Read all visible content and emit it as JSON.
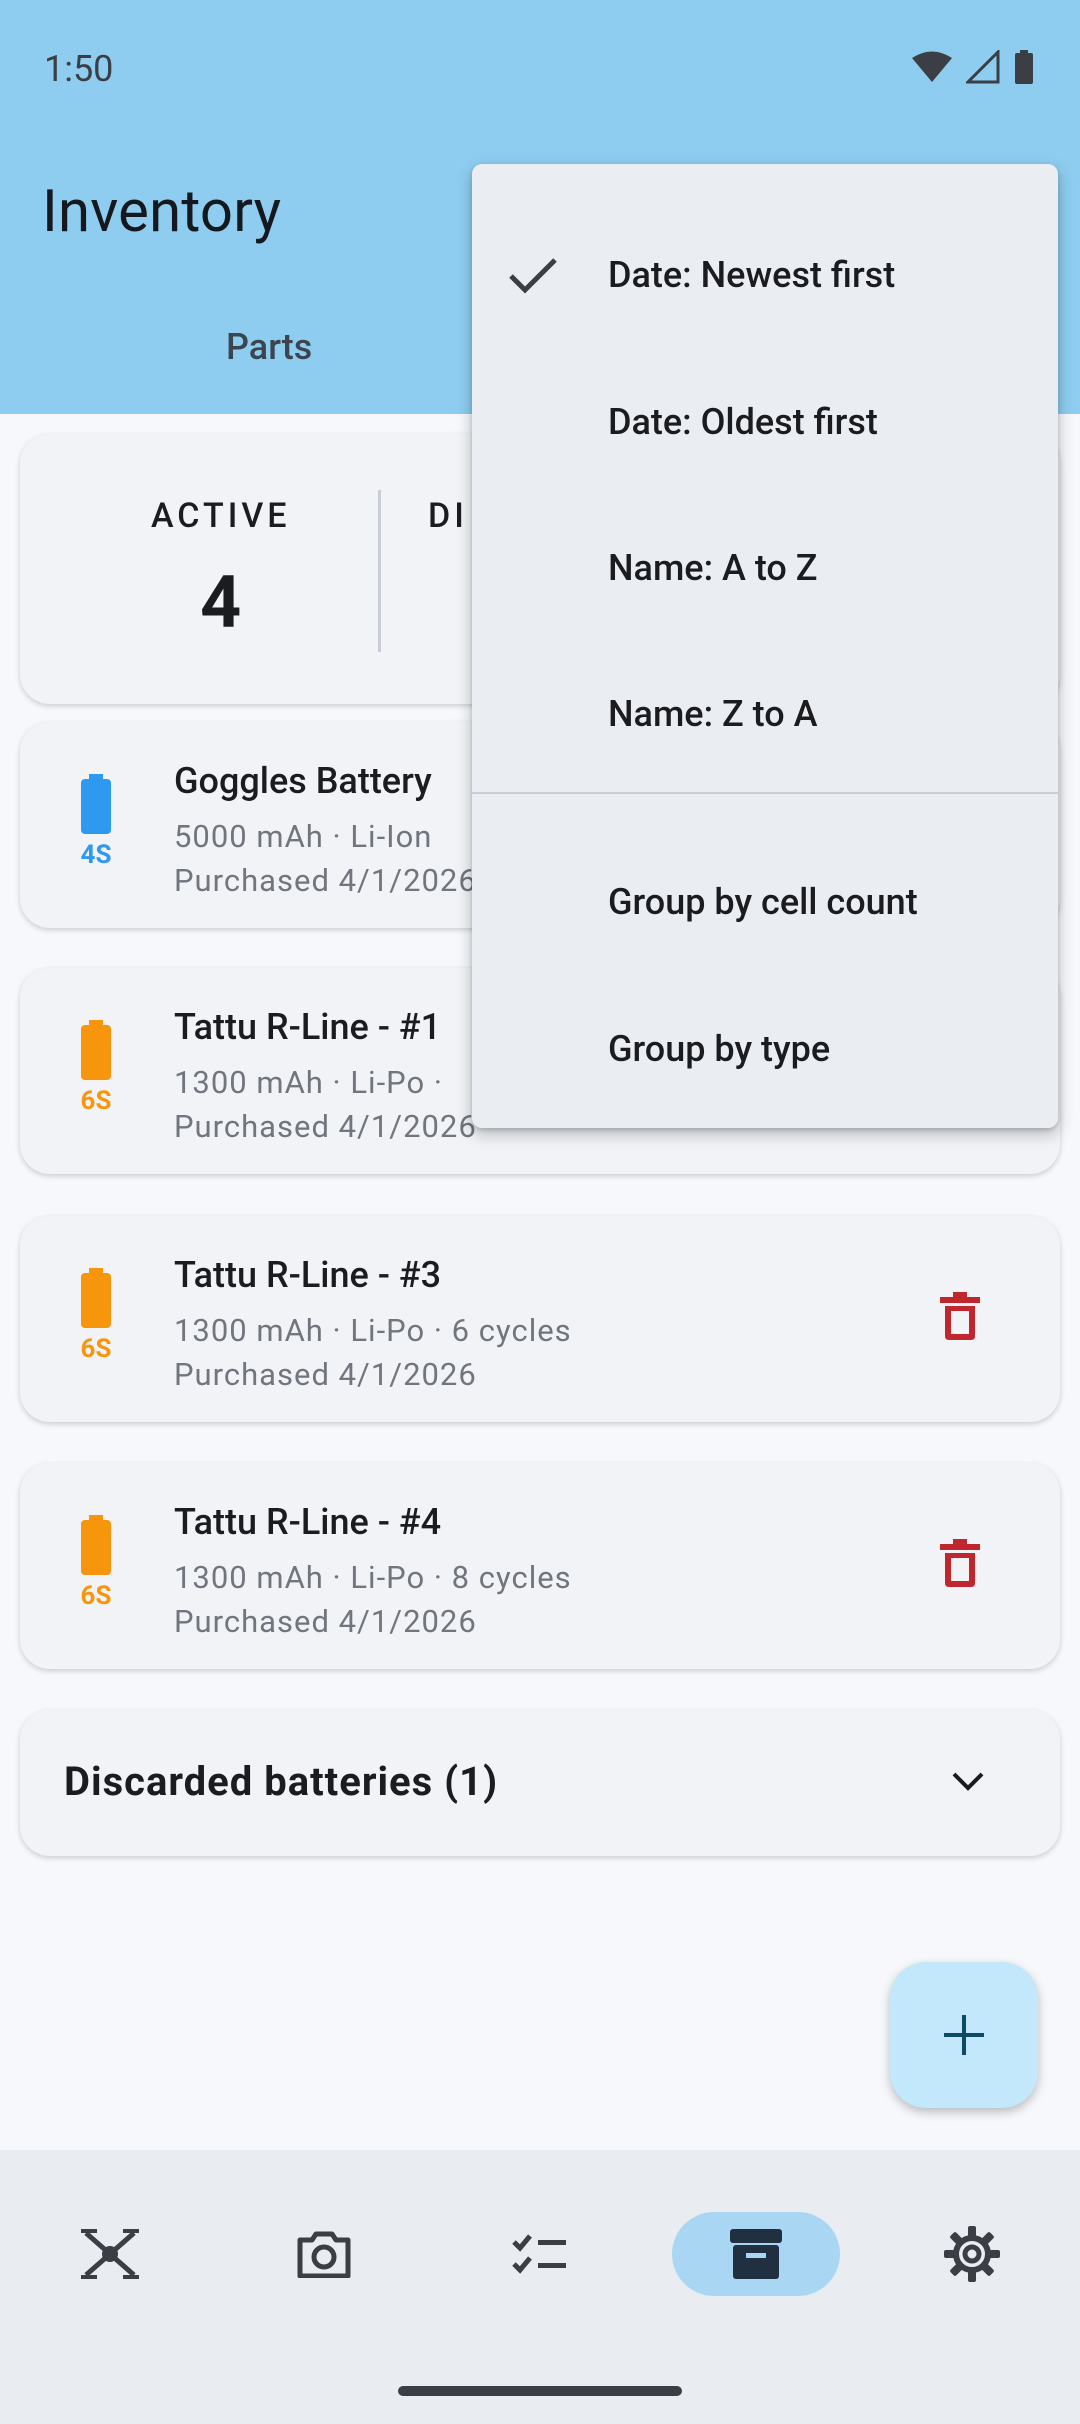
{
  "status_bar": {
    "time": "1:50"
  },
  "appbar": {
    "title": "Inventory",
    "tab_parts": "Parts"
  },
  "summary": {
    "active_label": "ACTIVE",
    "active_value": "4",
    "second_label_partial": "DI"
  },
  "batteries": [
    {
      "name": "Goggles Battery",
      "specs": "5000 mAh  ·  Li-Ion",
      "purchased": "Purchased 4/1/2026",
      "cells": "4S",
      "color": "#2f98ef"
    },
    {
      "name": "Tattu R-Line - #1",
      "specs": "1300 mAh  ·  Li-Po  ·",
      "purchased": "Purchased 4/1/2026",
      "cells": "6S",
      "color": "#f7960c"
    },
    {
      "name": "Tattu R-Line - #3",
      "specs": "1300 mAh  ·  Li-Po  ·  6 cycles",
      "purchased": "Purchased 4/1/2026",
      "cells": "6S",
      "color": "#f7960c"
    },
    {
      "name": "Tattu R-Line - #4",
      "specs": "1300 mAh  ·  Li-Po  ·  8 cycles",
      "purchased": "Purchased 4/1/2026",
      "cells": "6S",
      "color": "#f7960c"
    }
  ],
  "discarded": {
    "label": "Discarded batteries (1)"
  },
  "sort_menu": {
    "items": [
      {
        "label": "Date: Newest first",
        "checked": true
      },
      {
        "label": "Date: Oldest first",
        "checked": false
      },
      {
        "label": "Name: A to Z",
        "checked": false
      },
      {
        "label": "Name: Z to A",
        "checked": false
      }
    ],
    "group_items": [
      {
        "label": "Group by cell count"
      },
      {
        "label": "Group by type"
      }
    ]
  },
  "bottom_nav": {
    "items": [
      {
        "icon": "drone-icon",
        "active": false
      },
      {
        "icon": "camera-icon",
        "active": false
      },
      {
        "icon": "checklist-icon",
        "active": false
      },
      {
        "icon": "archive-icon",
        "active": true
      },
      {
        "icon": "gear-icon",
        "active": false
      }
    ]
  },
  "colors": {
    "appbar": "#8ecdf0",
    "accent_blue": "#2f98ef",
    "accent_orange": "#f7960c",
    "delete_red": "#c0262d",
    "fab": "#c4e8fb"
  }
}
